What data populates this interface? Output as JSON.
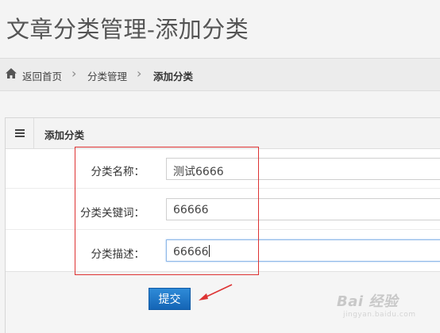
{
  "header": {
    "title": "文章分类管理-添加分类"
  },
  "breadcrumb": {
    "home": "返回首页",
    "category": "分类管理",
    "current": "添加分类"
  },
  "panel": {
    "title": "添加分类"
  },
  "form": {
    "name_label": "分类名称：",
    "name_value": "测试6666",
    "keywords_label": "分类关键词：",
    "keywords_value": "66666",
    "desc_label": "分类描述：",
    "desc_value": "66666",
    "submit_label": "提交"
  },
  "watermark": {
    "text": "Bai 经验",
    "sub": "jingyan.baidu.com"
  },
  "colors": {
    "accent": "#1a6fc4",
    "highlight": "#dd3333"
  }
}
